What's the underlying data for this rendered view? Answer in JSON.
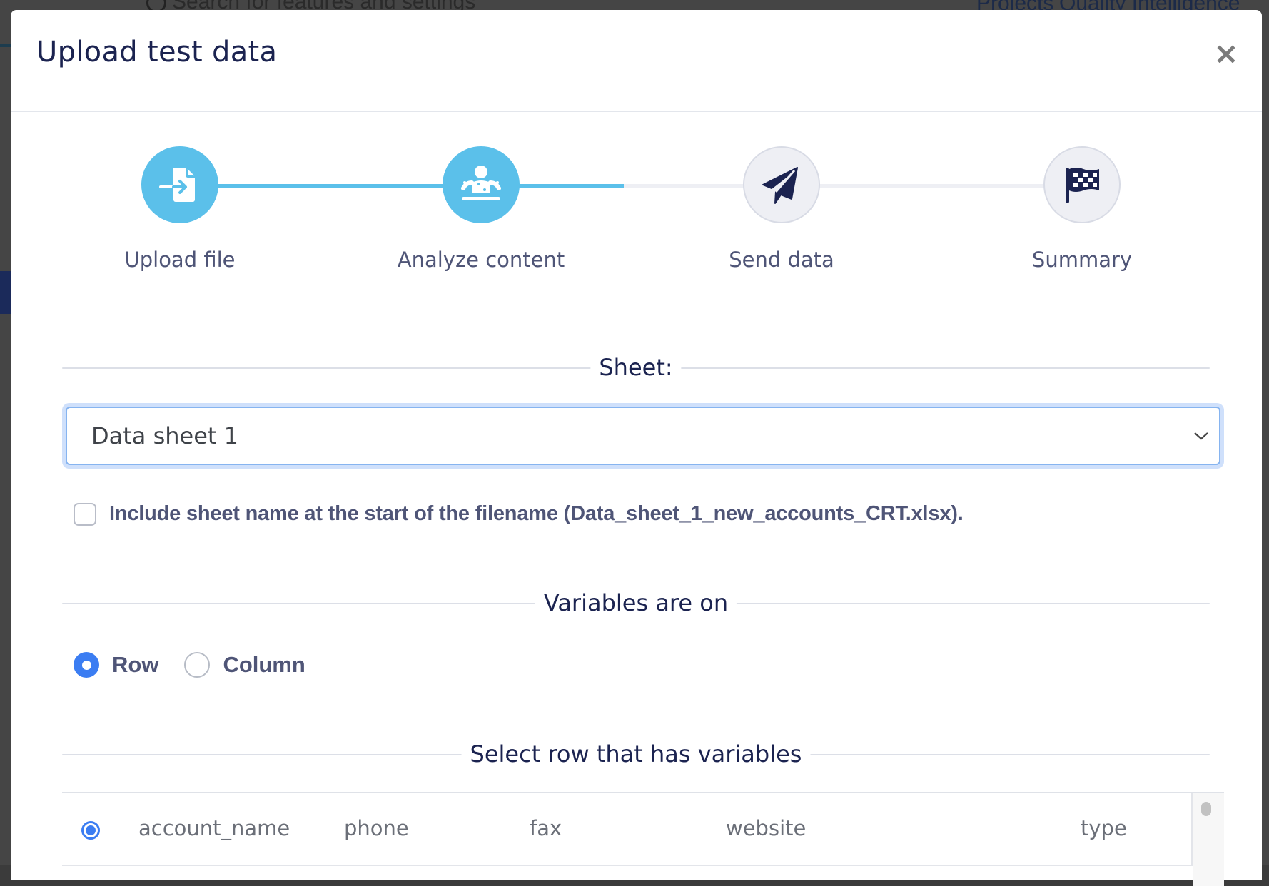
{
  "background": {
    "search_placeholder": "Search for features and settings",
    "nav_items": [
      "Projects",
      "Quality Intelligence"
    ]
  },
  "modal": {
    "title": "Upload test data",
    "close_icon": "close-icon"
  },
  "stepper": {
    "progress_percent": 50,
    "steps": [
      {
        "label": "Upload file",
        "icon": "file-import-icon",
        "state": "completed"
      },
      {
        "label": "Analyze content",
        "icon": "analyze-person-icon",
        "state": "active"
      },
      {
        "label": "Send data",
        "icon": "paper-plane-icon",
        "state": "pending"
      },
      {
        "label": "Summary",
        "icon": "checkered-flag-icon",
        "state": "pending"
      }
    ]
  },
  "sheet_section": {
    "heading": "Sheet:",
    "selected": "Data sheet 1",
    "include_name_label": "Include sheet name at the start of the filename (Data_sheet_1_new_accounts_CRT.xlsx).",
    "include_name_checked": false
  },
  "variables_section": {
    "heading": "Variables are on",
    "options": [
      "Row",
      "Column"
    ],
    "selected": "Row"
  },
  "row_section": {
    "heading": "Select row that has variables",
    "rows": [
      {
        "selected": true,
        "cells": [
          "account_name",
          "phone",
          "fax",
          "website",
          "type"
        ]
      }
    ]
  },
  "colors": {
    "accent": "#5bc0ea",
    "radio_blue": "#3b7df2",
    "title_navy": "#1b2350",
    "label_slate": "#4f5577"
  }
}
